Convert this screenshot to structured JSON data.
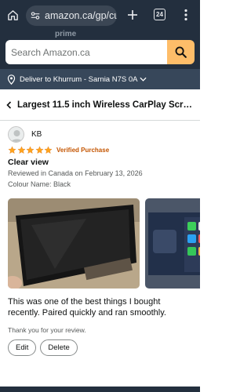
{
  "browser": {
    "url": "amazon.ca/gp/cu",
    "tab_count": "24",
    "icons": [
      "home-icon",
      "site-settings-icon",
      "plus-icon",
      "tabs-icon",
      "more-vert-icon"
    ]
  },
  "header": {
    "logo_fragment": "prime",
    "search_placeholder": "Search Amazon.ca",
    "colors": {
      "header_bg": "#232f3e",
      "search_button": "#febd69",
      "deliver_bg": "#37475a"
    }
  },
  "deliver": {
    "label": "Deliver to Khurrum - Sarnia N7S 0A"
  },
  "product": {
    "title": "Largest 11.5 inch Wireless CarPlay Scree..."
  },
  "review": {
    "reviewer": "KB",
    "rating": 5,
    "rating_max": 5,
    "verified_label": "Verified Purchase",
    "title": "Clear view",
    "date": "Reviewed in Canada on February 13, 2026",
    "colour": "Colour Name: Black",
    "body": "This was one of the best things I bought recently. Paired quickly and ran smoothly.",
    "thanks": "Thank you for your review.",
    "edit_label": "Edit",
    "delete_label": "Delete",
    "star_color": "#ffa41c",
    "verified_color": "#c45500"
  }
}
